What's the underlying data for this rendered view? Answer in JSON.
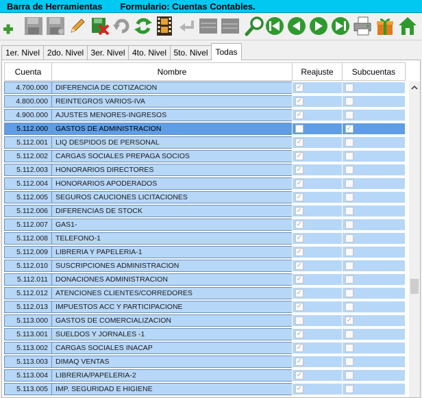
{
  "title": {
    "left": "Barra de Herramientas",
    "form": "Formulario: Cuentas Contables."
  },
  "toolbar": [
    {
      "icon": "add-icon"
    },
    {
      "icon": "save-icon"
    },
    {
      "icon": "save-as-icon"
    },
    {
      "icon": "edit-icon"
    },
    {
      "icon": "delete-icon"
    },
    {
      "icon": "undo-icon"
    },
    {
      "icon": "refresh-icon"
    },
    {
      "icon": "film-icon"
    },
    {
      "icon": "return-icon"
    },
    {
      "icon": "grid-icon"
    },
    {
      "icon": "list-icon"
    },
    {
      "icon": "search-icon"
    },
    {
      "icon": "first-record-icon"
    },
    {
      "icon": "previous-record-icon"
    },
    {
      "icon": "next-record-icon"
    },
    {
      "icon": "last-record-icon"
    },
    {
      "icon": "print-icon"
    },
    {
      "icon": "gift-icon"
    },
    {
      "icon": "home-icon"
    }
  ],
  "tabs": [
    "1er. Nivel",
    "2do. Nivel",
    "3er. Nivel",
    "4to. Nivel",
    "5to. Nivel",
    "Todas"
  ],
  "active_tab": "Todas",
  "columns": {
    "cuenta": "Cuenta",
    "nombre": "Nombre",
    "reajuste": "Reajuste",
    "subcuentas": "Subcuentas"
  },
  "rows": [
    {
      "cuenta": "4.700.000",
      "nombre": "DIFERENCIA DE COTIZACION",
      "reajuste": true,
      "subcuentas": false
    },
    {
      "cuenta": "4.800.000",
      "nombre": "REINTEGROS VARIOS-IVA",
      "reajuste": true,
      "subcuentas": false
    },
    {
      "cuenta": "4.900.000",
      "nombre": "AJUSTES MENORES-INGRESOS",
      "reajuste": true,
      "subcuentas": false
    },
    {
      "cuenta": "5.112.000",
      "nombre": "GASTOS DE ADMINISTRACION",
      "reajuste": false,
      "subcuentas": true,
      "selected": true
    },
    {
      "cuenta": "5.112.001",
      "nombre": "LIQ DESPIDOS DE PERSONAL",
      "reajuste": true,
      "subcuentas": false
    },
    {
      "cuenta": "5.112.002",
      "nombre": "CARGAS SOCIALES PREPAGA SOCIOS",
      "reajuste": true,
      "subcuentas": false
    },
    {
      "cuenta": "5.112.003",
      "nombre": "HONORARIOS DIRECTORES",
      "reajuste": true,
      "subcuentas": false
    },
    {
      "cuenta": "5.112.004",
      "nombre": "HONORARIOS APODERADOS",
      "reajuste": true,
      "subcuentas": false
    },
    {
      "cuenta": "5.112.005",
      "nombre": "SEGUROS CAUCIONES LICITACIONES",
      "reajuste": true,
      "subcuentas": false
    },
    {
      "cuenta": "5.112.006",
      "nombre": "DIFERENCIAS DE STOCK",
      "reajuste": true,
      "subcuentas": false
    },
    {
      "cuenta": "5.112.007",
      "nombre": "GAS1-",
      "reajuste": true,
      "subcuentas": false
    },
    {
      "cuenta": "5.112.008",
      "nombre": "TELEFONO-1",
      "reajuste": true,
      "subcuentas": false
    },
    {
      "cuenta": "5.112.009",
      "nombre": "LIBRERIA Y PAPELERIA-1",
      "reajuste": true,
      "subcuentas": false
    },
    {
      "cuenta": "5.112.010",
      "nombre": "SUSCRIPCIONES ADMINISTRACION",
      "reajuste": true,
      "subcuentas": false
    },
    {
      "cuenta": "5.112.011",
      "nombre": "DONACIONES ADMINISTRACION",
      "reajuste": true,
      "subcuentas": false
    },
    {
      "cuenta": "5.112.012",
      "nombre": "ATENCIONES CLIENTES/CORREDORES",
      "reajuste": true,
      "subcuentas": false
    },
    {
      "cuenta": "5.112.013",
      "nombre": "IMPUESTOS ACC Y PARTICIPACIONE",
      "reajuste": true,
      "subcuentas": false
    },
    {
      "cuenta": "5.113.000",
      "nombre": "GASTOS DE COMERCIALIZACION",
      "reajuste": false,
      "subcuentas": true
    },
    {
      "cuenta": "5.113.001",
      "nombre": "SUELDOS Y JORNALES -1",
      "reajuste": true,
      "subcuentas": false
    },
    {
      "cuenta": "5.113.002",
      "nombre": "CARGAS SOCIALES INACAP",
      "reajuste": true,
      "subcuentas": false
    },
    {
      "cuenta": "5.113.003",
      "nombre": "DIMAQ VENTAS",
      "reajuste": true,
      "subcuentas": false
    },
    {
      "cuenta": "5.113.004",
      "nombre": "LIBRERIA/PAPELERIA-2",
      "reajuste": true,
      "subcuentas": false
    },
    {
      "cuenta": "5.113.005",
      "nombre": "IMP. SEGURIDAD E HIGIENE",
      "reajuste": true,
      "subcuentas": false
    }
  ],
  "colors": {
    "title_bar": "#00c8f0",
    "row_bg": "#b7d7f8",
    "selected_row_bg": "#5f9ee6",
    "cell_border": "#6d8fb4"
  }
}
